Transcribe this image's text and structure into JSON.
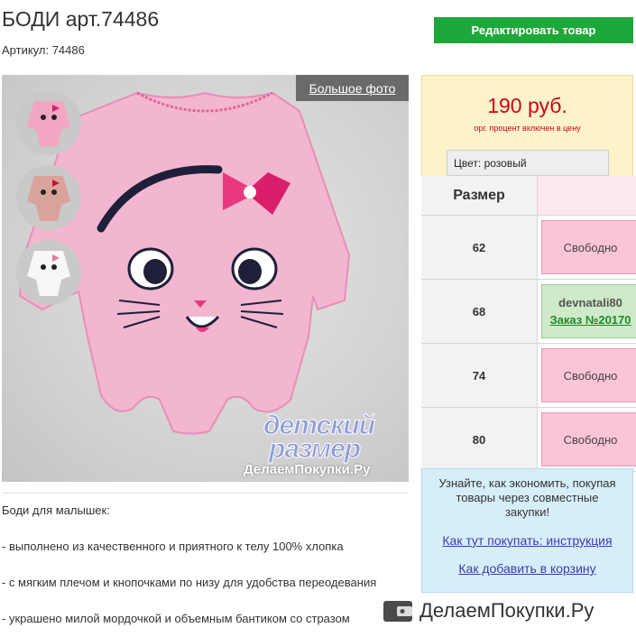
{
  "product": {
    "title": "БОДИ арт.74486",
    "article": "Артикул: 74486"
  },
  "toolbar": {
    "edit_label": "Редактировать товар"
  },
  "photo": {
    "big_photo_label": "Большое фото",
    "watermark_line1": "детский",
    "watermark_line2": "размер",
    "watermark_line3": "ДелаемПокупки.Ру"
  },
  "price": {
    "value": "190 руб.",
    "note": "орг. процент включен в цену",
    "color_label": "Цвет:",
    "color_value": "розовый"
  },
  "sizes": {
    "header": "Размер",
    "rows": [
      {
        "size": "62",
        "status": "Свободно"
      },
      {
        "size": "68",
        "user": "devnatali80",
        "order": "Заказ №20170"
      },
      {
        "size": "74",
        "status": "Свободно"
      },
      {
        "size": "80",
        "status": "Свободно"
      }
    ]
  },
  "description": {
    "lines": [
      "Боди для малышек:",
      "- выполнено из качественного и приятного к телу 100% хлопка",
      "- с мягким плечом и кнопочками по низу для удобства переодевания",
      "- украшено милой мордочкой и объемным бантиком со стразом"
    ]
  },
  "info": {
    "text": "Узнайте, как экономить, покупая товары через совместные закупки!",
    "link1": "Как тут покупать: инструкция",
    "link2": "Как добавить в корзину"
  },
  "footer": {
    "brand": "ДелаемПокупки.Ру"
  },
  "colors": {
    "edit_button": "#1fa83a",
    "price": "#d0021b",
    "free_cell": "#fbc5d8",
    "taken_cell": "#cfeac9",
    "info_box": "#d6eefa",
    "price_box": "#fdf3c8"
  }
}
